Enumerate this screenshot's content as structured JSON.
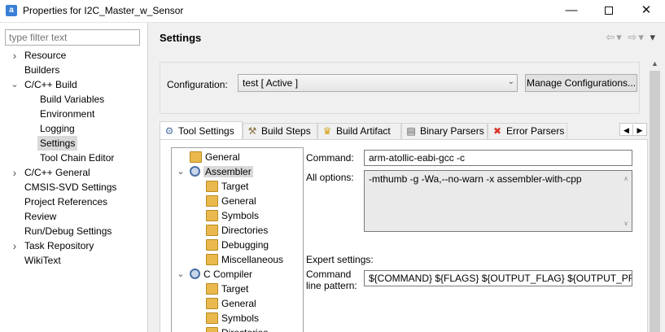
{
  "window": {
    "title": "Properties for I2C_Master_w_Sensor",
    "min_glyph": "—",
    "max_glyph": "",
    "close_glyph": "✕"
  },
  "left": {
    "filter_placeholder": "type filter text",
    "tree": [
      {
        "label": "Resource",
        "arrow": "›",
        "indent": 0
      },
      {
        "label": "Builders",
        "arrow": "",
        "indent": 0
      },
      {
        "label": "C/C++ Build",
        "arrow": "⌄",
        "indent": 0
      },
      {
        "label": "Build Variables",
        "arrow": "",
        "indent": 1
      },
      {
        "label": "Environment",
        "arrow": "",
        "indent": 1
      },
      {
        "label": "Logging",
        "arrow": "",
        "indent": 1
      },
      {
        "label": "Settings",
        "arrow": "",
        "indent": 1,
        "selected": true
      },
      {
        "label": "Tool Chain Editor",
        "arrow": "",
        "indent": 1
      },
      {
        "label": "C/C++ General",
        "arrow": "›",
        "indent": 0
      },
      {
        "label": "CMSIS-SVD Settings",
        "arrow": "",
        "indent": 0
      },
      {
        "label": "Project References",
        "arrow": "",
        "indent": 0
      },
      {
        "label": "Review",
        "arrow": "",
        "indent": 0
      },
      {
        "label": "Run/Debug Settings",
        "arrow": "",
        "indent": 0
      },
      {
        "label": "Task Repository",
        "arrow": "›",
        "indent": 0
      },
      {
        "label": "WikiText",
        "arrow": "",
        "indent": 0
      }
    ]
  },
  "main": {
    "title": "Settings",
    "nav": {
      "back": "⇦",
      "back_dd": "▾",
      "forward": "⇨",
      "forward_dd": "▾",
      "menu": "▾"
    },
    "config_label": "Configuration:",
    "config_value": "test  [ Active ]",
    "dropdown_glyph": "⌄",
    "manage_label": "Manage Configurations...",
    "tabs": [
      {
        "label": "Tool Settings",
        "icon": "tool-settings-icon",
        "glyph": "⚙",
        "color": "#4a6fa5",
        "active": true
      },
      {
        "label": "Build Steps",
        "icon": "build-steps-icon",
        "glyph": "⚒",
        "color": "#8a6d3b"
      },
      {
        "label": "Build Artifact",
        "icon": "build-artifact-icon",
        "glyph": "♛",
        "color": "#d4a017"
      },
      {
        "label": "Binary Parsers",
        "icon": "binary-parsers-icon",
        "glyph": "▤",
        "color": "#555555"
      },
      {
        "label": "Error Parsers",
        "icon": "error-parsers-icon",
        "glyph": "✖",
        "color": "#d9352b"
      }
    ],
    "tabscroll": {
      "left": "◀",
      "right": "▶"
    },
    "tool_tree": [
      {
        "label": "General",
        "icon": "folder",
        "indent": 1,
        "arrow": ""
      },
      {
        "label": "Assembler",
        "icon": "gear",
        "indent": 1,
        "arrow": "⌄",
        "selected": true
      },
      {
        "label": "Target",
        "icon": "folder",
        "indent": 2,
        "arrow": ""
      },
      {
        "label": "General",
        "icon": "folder",
        "indent": 2,
        "arrow": ""
      },
      {
        "label": "Symbols",
        "icon": "folder",
        "indent": 2,
        "arrow": ""
      },
      {
        "label": "Directories",
        "icon": "folder",
        "indent": 2,
        "arrow": ""
      },
      {
        "label": "Debugging",
        "icon": "folder",
        "indent": 2,
        "arrow": ""
      },
      {
        "label": "Miscellaneous",
        "icon": "folder",
        "indent": 2,
        "arrow": ""
      },
      {
        "label": "C Compiler",
        "icon": "gear",
        "indent": 1,
        "arrow": "⌄"
      },
      {
        "label": "Target",
        "icon": "folder",
        "indent": 2,
        "arrow": ""
      },
      {
        "label": "General",
        "icon": "folder",
        "indent": 2,
        "arrow": ""
      },
      {
        "label": "Symbols",
        "icon": "folder",
        "indent": 2,
        "arrow": ""
      },
      {
        "label": "Directories",
        "icon": "folder",
        "indent": 2,
        "arrow": ""
      }
    ],
    "command_label": "Command:",
    "command_value": "arm-atollic-eabi-gcc -c",
    "all_options_label": "All options:",
    "all_options_value": "-mthumb -g -Wa,--no-warn -x assembler-with-cpp",
    "ta_up": "∧",
    "ta_down": "∨",
    "expert_label": "Expert settings:",
    "pattern_label_1": "Command",
    "pattern_label_2": "line pattern:",
    "pattern_value": "${COMMAND} ${FLAGS} ${OUTPUT_FLAG} ${OUTPUT_PREFIX}",
    "scroll_up": "▲"
  }
}
